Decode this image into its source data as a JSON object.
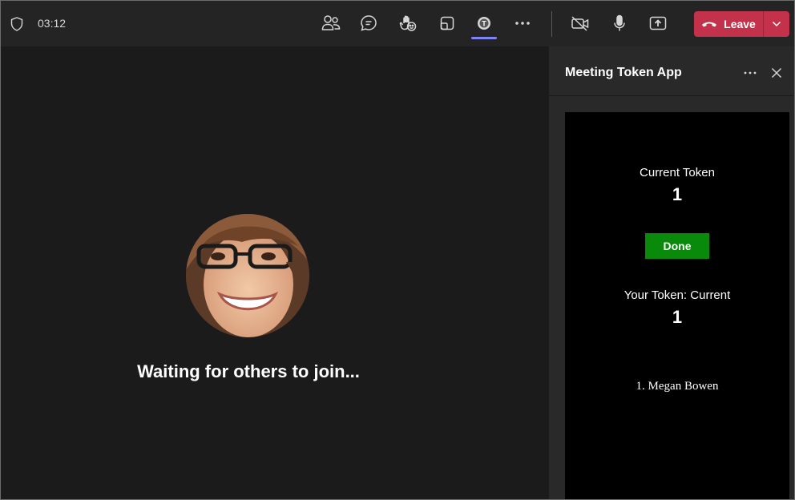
{
  "topbar": {
    "timer": "03:12",
    "leave_label": "Leave",
    "icons": [
      "shield-icon",
      "people-icon",
      "chat-icon",
      "raise-hand-icon",
      "rooms-icon",
      "token-app-icon",
      "more-icon",
      "camera-off-icon",
      "mic-icon",
      "share-icon",
      "phone-icon",
      "chevron-down-icon"
    ],
    "active_color": "#7f85f5",
    "leave_color": "#c4314b"
  },
  "stage": {
    "waiting_text": "Waiting for others to join..."
  },
  "panel": {
    "title": "Meeting Token App",
    "app": {
      "current_token_label": "Current Token",
      "current_token_value": "1",
      "done_label": "Done",
      "your_token_label": "Your Token: Current",
      "your_token_value": "1",
      "queue": [
        "1. Megan Bowen"
      ],
      "done_color": "#0a8a0a"
    }
  }
}
